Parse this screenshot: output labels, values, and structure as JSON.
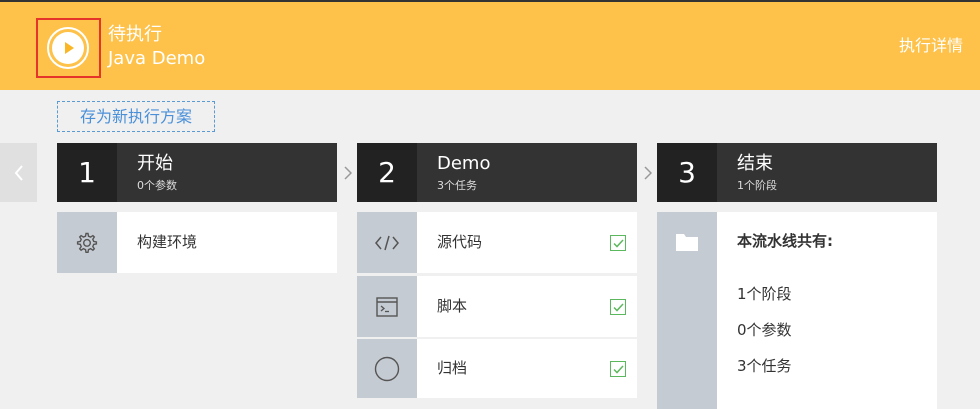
{
  "header": {
    "status": "待执行",
    "name": "Java Demo",
    "details_link": "执行详情"
  },
  "toolbar": {
    "save_button": "存为新执行方案"
  },
  "stages": [
    {
      "number": "1",
      "title": "开始",
      "subtitle": "0个参数",
      "items": [
        {
          "label": "构建环境",
          "icon": "gear-icon",
          "checked": false
        }
      ]
    },
    {
      "number": "2",
      "title": "Demo",
      "subtitle": "3个任务",
      "items": [
        {
          "label": "源代码",
          "icon": "code-icon",
          "checked": true
        },
        {
          "label": "脚本",
          "icon": "terminal-icon",
          "checked": true
        },
        {
          "label": "归档",
          "icon": "circle-icon",
          "checked": true
        }
      ]
    },
    {
      "number": "3",
      "title": "结束",
      "subtitle": "1个阶段",
      "summary": {
        "title": "本流水线共有:",
        "lines": [
          "1个阶段",
          "0个参数",
          "3个任务"
        ]
      }
    }
  ],
  "colors": {
    "header_bg": "#fec24a",
    "stage_header_bg": "#333333",
    "stage_number_bg": "#222222",
    "icon_column_bg": "#c5cbd2",
    "check_color": "#5cb85c",
    "highlight_border": "#e5352b",
    "link_blue": "#4a90d9"
  }
}
